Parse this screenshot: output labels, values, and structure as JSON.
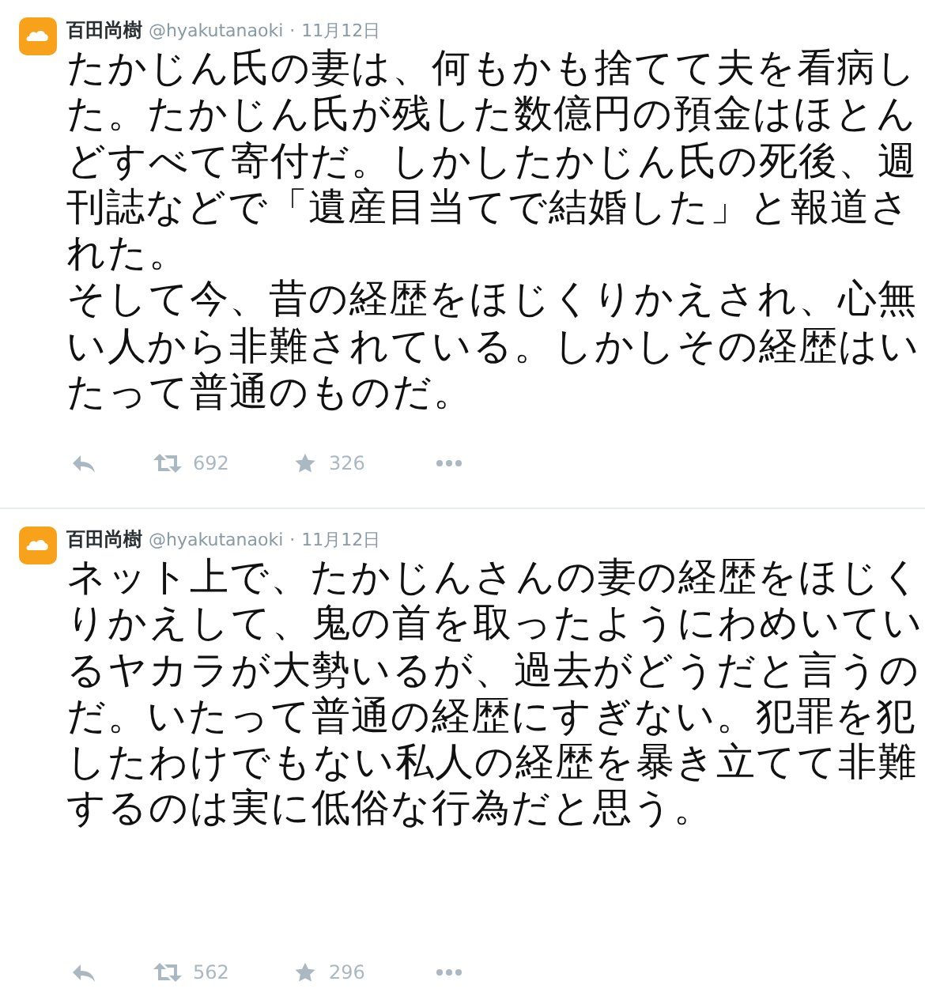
{
  "tweets": [
    {
      "name": "百田尚樹",
      "handle": "@hyakutanaoki",
      "separator": "·",
      "date": "11月12日",
      "paragraphs": [
        "たかじん氏の妻は、何もかも捨てて夫を看病した。たかじん氏が残した数億円の預金はほとんどすべて寄付だ。しかしたかじん氏の死後、週刊誌などで「遺産目当てで結婚した」と報道された。",
        "そして今、昔の経歴をほじくりかえされ、心無い人から非難されている。しかしその経歴はいたって普通のものだ。"
      ],
      "retweets": "692",
      "favorites": "326"
    },
    {
      "name": "百田尚樹",
      "handle": "@hyakutanaoki",
      "separator": "·",
      "date": "11月12日",
      "paragraphs": [
        "ネット上で、たかじんさんの妻の経歴をほじくりかえして、鬼の首を取ったようにわめいているヤカラが大勢いるが、過去がどうだと言うのだ。いたって普通の経歴にすぎない。犯罪を犯したわけでもない私人の経歴を暴き立てて非難するのは実に低俗な行為だと思う。"
      ],
      "retweets": "562",
      "favorites": "296"
    }
  ]
}
